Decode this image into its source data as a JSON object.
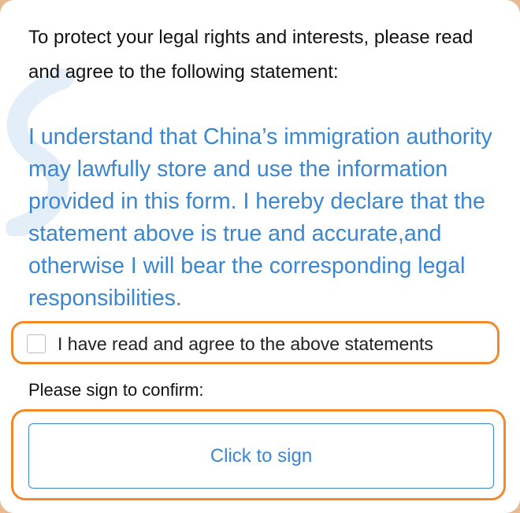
{
  "intro_text": "To protect your legal rights and interests, please read and agree to the following statement:",
  "statement_text": "I understand that China’s immigration authority may lawfully store and use the information provided in this form. I hereby declare that the statement above is true and accurate,and otherwise I will bear the corresponding legal responsibilities.",
  "agreement": {
    "checked": false,
    "label": "I have read and agree to the above statements"
  },
  "sign_prompt": "Please sign to confirm:",
  "sign_button_label": "Click to sign",
  "colors": {
    "statement": "#3a86d1",
    "highlight_frame": "#f08a2a",
    "background": "#e9b98f"
  }
}
